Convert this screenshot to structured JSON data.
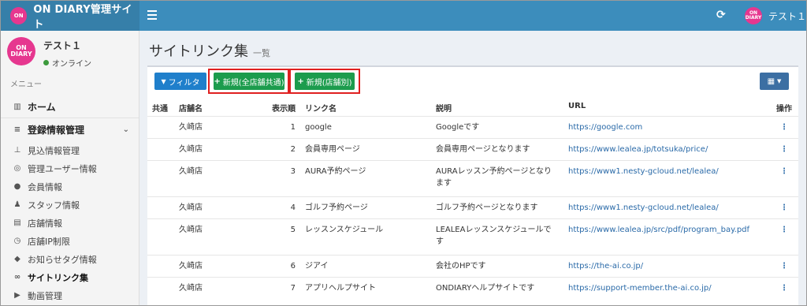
{
  "header": {
    "app_title": "ON DIARY管理サイト",
    "logo_text": "ON DIARY",
    "menu_icon": "hamburger-icon",
    "refresh_icon": "refresh-icon",
    "user_name": "テスト１",
    "avatar_text": "ON DIARY"
  },
  "sidebar": {
    "user_name": "テスト１",
    "status": "オンライン",
    "menu_label": "メニュー",
    "home": {
      "icon": "bar-chart-icon",
      "label": "ホーム"
    },
    "section": {
      "icon": "list-icon",
      "label": "登録情報管理"
    },
    "items": [
      {
        "icon": "thumb-tack-icon",
        "label": "見込情報管理"
      },
      {
        "icon": "eye-slash-icon",
        "label": "管理ユーザー情報"
      },
      {
        "icon": "users-icon",
        "label": "会員情報"
      },
      {
        "icon": "user-icon",
        "label": "スタッフ情報"
      },
      {
        "icon": "store-icon",
        "label": "店舗情報"
      },
      {
        "icon": "clock-icon",
        "label": "店舗IP制限"
      },
      {
        "icon": "tag-icon",
        "label": "お知らせタグ情報"
      },
      {
        "icon": "link-icon",
        "label": "サイトリンク集"
      },
      {
        "icon": "video-icon",
        "label": "動画管理"
      }
    ]
  },
  "page": {
    "title": "サイトリンク集",
    "subtitle": "一覧"
  },
  "toolbar": {
    "filter_label": "フィルタ",
    "new_all_label": "新規(全店舗共通)",
    "new_store_label": "新規(店舗別)",
    "columns_icon": "table-icon"
  },
  "table": {
    "headers": [
      "共通",
      "店舗名",
      "表示順",
      "リンク名",
      "説明",
      "URL",
      "操作"
    ],
    "rows": [
      {
        "common": "",
        "store": "久崎店",
        "order": "1",
        "name": "google",
        "desc": "Googleです",
        "url": "https://google.com"
      },
      {
        "common": "",
        "store": "久崎店",
        "order": "2",
        "name": "会員専用ページ",
        "desc": "会員専用ページとなります",
        "url": "https://www.lealea.jp/totsuka/price/"
      },
      {
        "common": "",
        "store": "久崎店",
        "order": "3",
        "name": "AURA予約ページ",
        "desc": "AURAレッスン予約ページとなります",
        "url": "https://www1.nesty-gcloud.net/lealea/"
      },
      {
        "common": "",
        "store": "久崎店",
        "order": "4",
        "name": "ゴルフ予約ページ",
        "desc": "ゴルフ予約ページとなります",
        "url": "https://www1.nesty-gcloud.net/lealea/"
      },
      {
        "common": "",
        "store": "久崎店",
        "order": "5",
        "name": "レッスンスケジュール",
        "desc": "LEALEAレッスンスケジュールです",
        "url": "https://www.lealea.jp/src/pdf/program_bay.pdf"
      },
      {
        "common": "",
        "store": "久崎店",
        "order": "6",
        "name": "ジアイ",
        "desc": "会社のHPです",
        "url": "https://the-ai.co.jp/"
      },
      {
        "common": "",
        "store": "久崎店",
        "order": "7",
        "name": "アプリヘルプサイト",
        "desc": "ONDIARYヘルプサイトです",
        "url": "https://support-member.the-ai.co.jp/"
      }
    ],
    "ops_glyph": "⋮"
  }
}
